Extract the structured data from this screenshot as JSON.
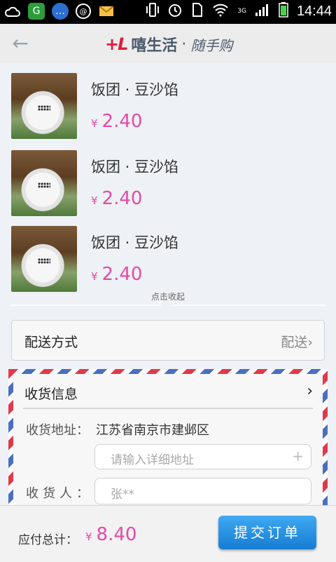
{
  "statusbar": {
    "time": "14:44",
    "network": "3G",
    "icons": [
      "cloud-icon",
      "app-icon",
      "chat-icon",
      "sync-icon",
      "mail-icon",
      "vibrate-icon",
      "alarm-icon",
      "sim-icon",
      "wifi-icon",
      "signal-icon",
      "battery-icon"
    ]
  },
  "header": {
    "logo": "+L",
    "name": "嘻生活",
    "separator": "·",
    "subtitle": "随手购"
  },
  "products": [
    {
      "name": "饭团 · 豆沙馅",
      "currency": "¥",
      "price": "2.40"
    },
    {
      "name": "饭团 · 豆沙馅",
      "currency": "¥",
      "price": "2.40"
    },
    {
      "name": "饭团 · 豆沙馅",
      "currency": "¥",
      "price": "2.40"
    }
  ],
  "collapse_text": "点击收起",
  "delivery": {
    "label": "配送方式",
    "value": "配送"
  },
  "receiver_info": {
    "title": "收货信息",
    "address_label": "收货地址：",
    "address_value": "江苏省南京市建邺区",
    "address_placeholder": "请输入详细地址",
    "receiver_label": "收货人：",
    "receiver_placeholder": "张**"
  },
  "footer": {
    "total_label": "应付总计：",
    "currency": "¥",
    "total_value": "8.40",
    "submit_label": "提交订单"
  },
  "colors": {
    "price": "#e44ba6",
    "submit": "#1f8be0",
    "logo": "#e01a3b"
  }
}
